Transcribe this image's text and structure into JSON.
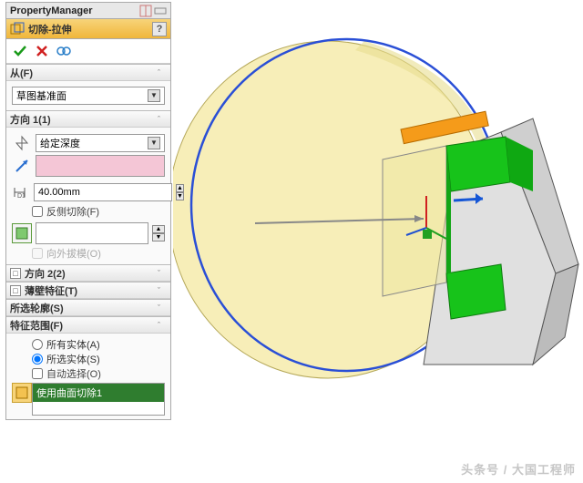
{
  "pm": {
    "title": "PropertyManager"
  },
  "feature": {
    "title": "切除-拉伸",
    "help": "?"
  },
  "from": {
    "header": "从(F)",
    "value": "草图基准面"
  },
  "dir1": {
    "header": "方向 1(1)",
    "endcond": "给定深度",
    "depth": "40.00mm",
    "flip": "反侧切除(F)",
    "draft_out": "向外拔模(O)"
  },
  "dir2": {
    "header": "方向 2(2)"
  },
  "thin": {
    "header": "薄壁特征(T)"
  },
  "contours": {
    "header": "所选轮廓(S)"
  },
  "scope": {
    "header": "特征范围(F)",
    "all": "所有实体(A)",
    "selected": "所选实体(S)",
    "auto": "自动选择(O)",
    "item": "使用曲面切除1"
  },
  "watermark": "头条号 / 大国工程师"
}
